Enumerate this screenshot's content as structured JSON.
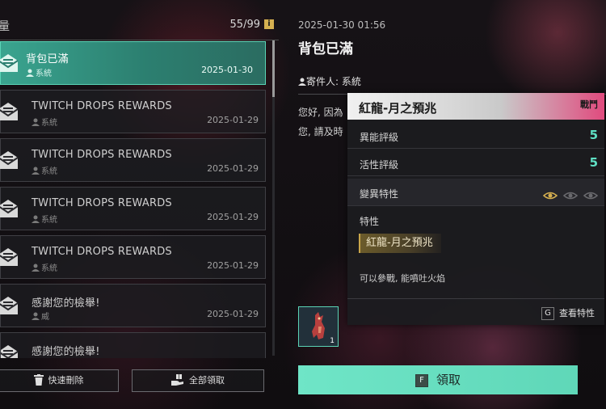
{
  "mailbox": {
    "title_fragment": "量",
    "count": "55/99",
    "info_icon": "i",
    "items": [
      {
        "subject": "背包已滿",
        "sender": "系統",
        "date": "2025-01-30",
        "active": true
      },
      {
        "subject": "TWITCH DROPS REWARDS",
        "sender": "系統",
        "date": "2025-01-29"
      },
      {
        "subject": "TWITCH DROPS REWARDS",
        "sender": "系統",
        "date": "2025-01-29"
      },
      {
        "subject": "TWITCH DROPS REWARDS",
        "sender": "系統",
        "date": "2025-01-29"
      },
      {
        "subject": "TWITCH DROPS REWARDS",
        "sender": "系統",
        "date": "2025-01-29"
      },
      {
        "subject": "感謝您的檢舉!",
        "sender": "威",
        "date": "2025-01-29"
      },
      {
        "subject": "感謝您的檢舉!",
        "sender": "",
        "date": ""
      }
    ],
    "quick_delete_label": "快速刪除",
    "claim_all_label": "全部領取"
  },
  "detail": {
    "datetime": "2025-01-30 01:56",
    "title": "背包已滿",
    "sender_label": "寄件人: 系統",
    "body_line1": "您好, 因為",
    "body_line2": "您, 請及時",
    "attachment_qty": "1",
    "claim_key": "F",
    "claim_label": "領取"
  },
  "tooltip": {
    "name": "紅龍-月之預兆",
    "tag": "戰鬥",
    "rows": [
      {
        "label": "異能評級",
        "value": "5"
      },
      {
        "label": "活性評級",
        "value": "5"
      }
    ],
    "mutation_label": "變異特性",
    "trait_section": "特性",
    "trait_name": "紅龍-月之預兆",
    "description": "可以參戰, 能噴吐火焰",
    "view_key": "G",
    "view_label": "查看特性"
  },
  "colors": {
    "accent": "#5fd7b8",
    "active_mail": "#3aa48f",
    "rating_value": "#5fe0c4",
    "tag_gradient_end": "#e04b7e",
    "trait_gold": "#c9a64a"
  },
  "icons": {
    "mail": "envelope-icon",
    "person": "person-icon",
    "trash": "trash-icon",
    "claim_all": "hand-gift-icon",
    "eye": "eye-icon",
    "info": "info-icon"
  }
}
